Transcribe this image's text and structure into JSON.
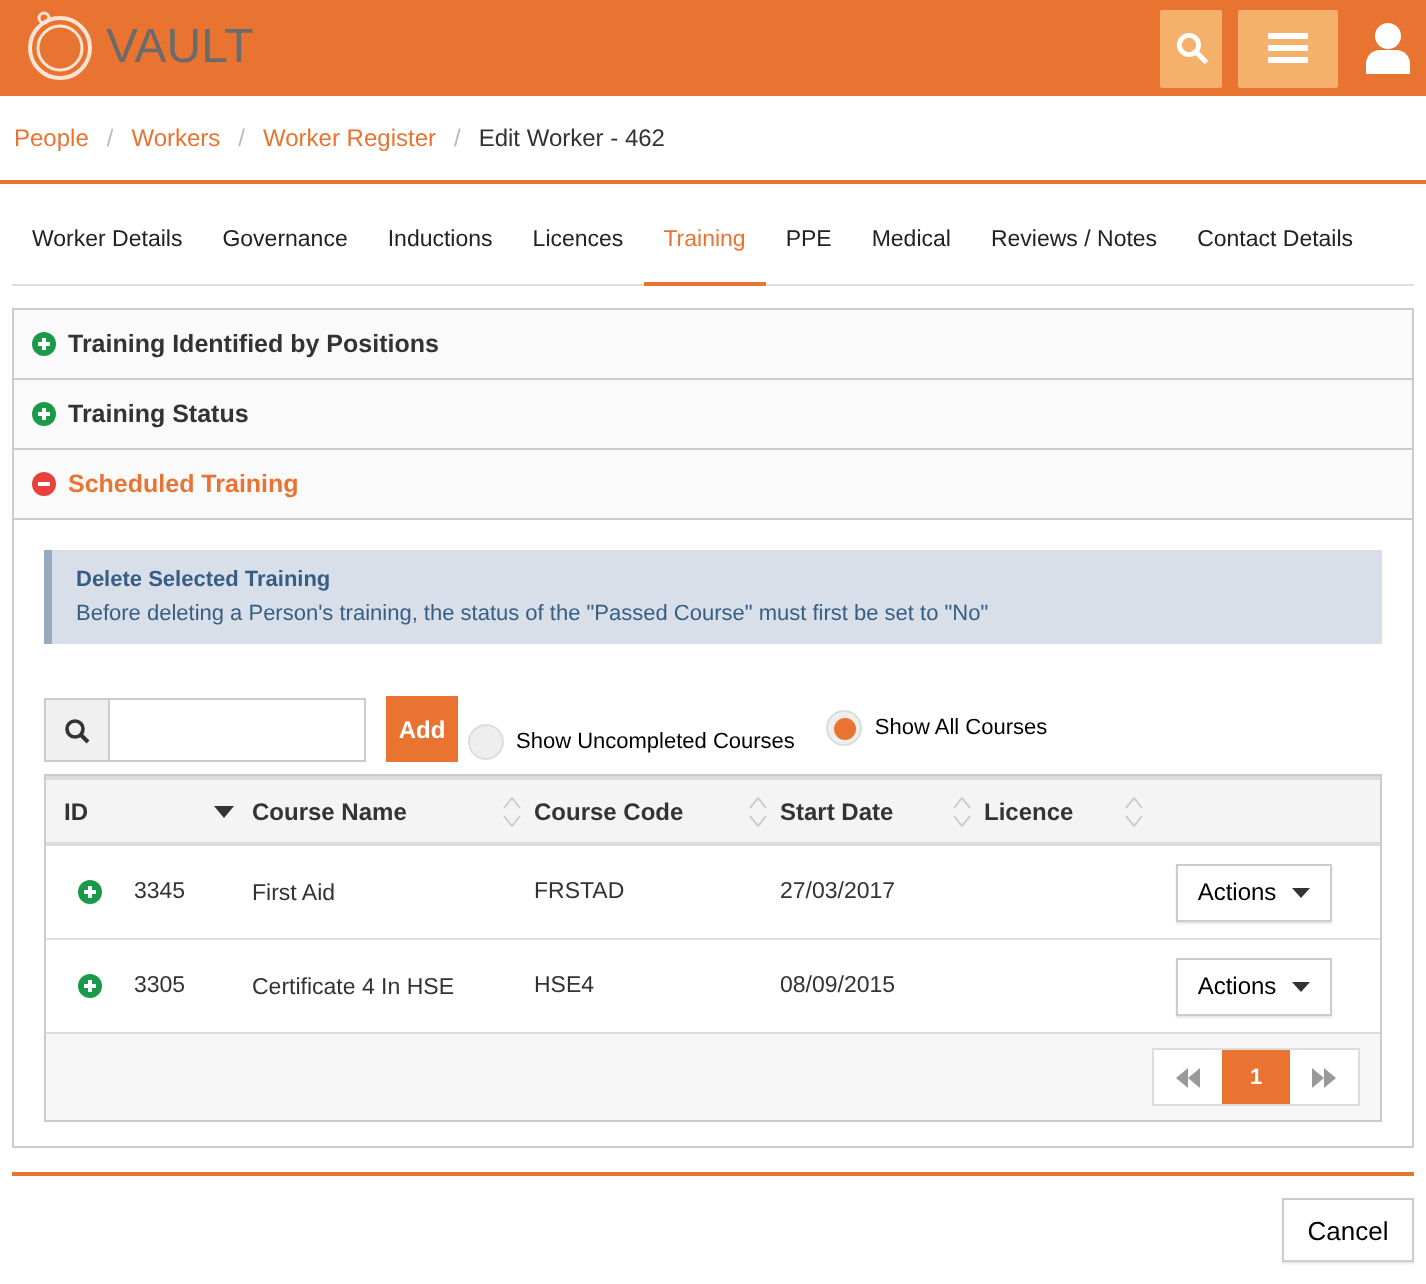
{
  "header": {
    "logo": "VAULT"
  },
  "breadcrumb": [
    {
      "label": "People",
      "link": true
    },
    {
      "separator": "/",
      "label": "Workers",
      "link": true
    },
    {
      "separator": "/",
      "label": "Worker Register",
      "link": true
    },
    {
      "separator": "/",
      "label": "Edit Worker - 462",
      "link": false
    }
  ],
  "tabs": [
    {
      "label": "Worker Details",
      "selected": false
    },
    {
      "label": "Governance",
      "selected": false
    },
    {
      "label": "Inductions",
      "selected": false
    },
    {
      "label": "Licences",
      "selected": false
    },
    {
      "label": "Training",
      "selected": true
    },
    {
      "label": "PPE",
      "selected": false
    },
    {
      "label": "Medical",
      "selected": false
    },
    {
      "label": "Reviews / Notes",
      "selected": false
    },
    {
      "label": "Contact Details",
      "selected": false
    }
  ],
  "sections": [
    {
      "title": "Training Identified by Positions",
      "expanded": false
    },
    {
      "title": "Training Status",
      "expanded": false
    },
    {
      "title": "Scheduled Training",
      "expanded": true
    }
  ],
  "notice": {
    "title": "Delete Selected Training",
    "text": "Before deleting a Person's training, the status of the \"Passed Course\" must first be set to \"No\""
  },
  "toolbar": {
    "add_label": "Add",
    "filters": [
      {
        "label": "Show Uncompleted Courses",
        "selected": false
      },
      {
        "label": "Show All Courses",
        "selected": true
      }
    ]
  },
  "table": {
    "columns": [
      {
        "label": "ID",
        "sorted": true
      },
      {
        "label": "Course Name",
        "sorted": false
      },
      {
        "label": "Course Code",
        "sorted": false
      },
      {
        "label": "Start Date",
        "sorted": false
      },
      {
        "label": "Licence",
        "sorted": false
      }
    ],
    "rows": [
      {
        "id": "3345",
        "course_name": "First Aid",
        "course_code": "FRSTAD",
        "start_date": "27/03/2017",
        "action": "Actions"
      },
      {
        "id": "3305",
        "course_name": "Certificate 4 In HSE",
        "course_code": "HSE4",
        "start_date": "08/09/2015",
        "action": "Actions"
      }
    ],
    "pages": [
      {
        "label": "1",
        "selected": true
      }
    ]
  },
  "footer": {
    "cancel": "Cancel"
  }
}
